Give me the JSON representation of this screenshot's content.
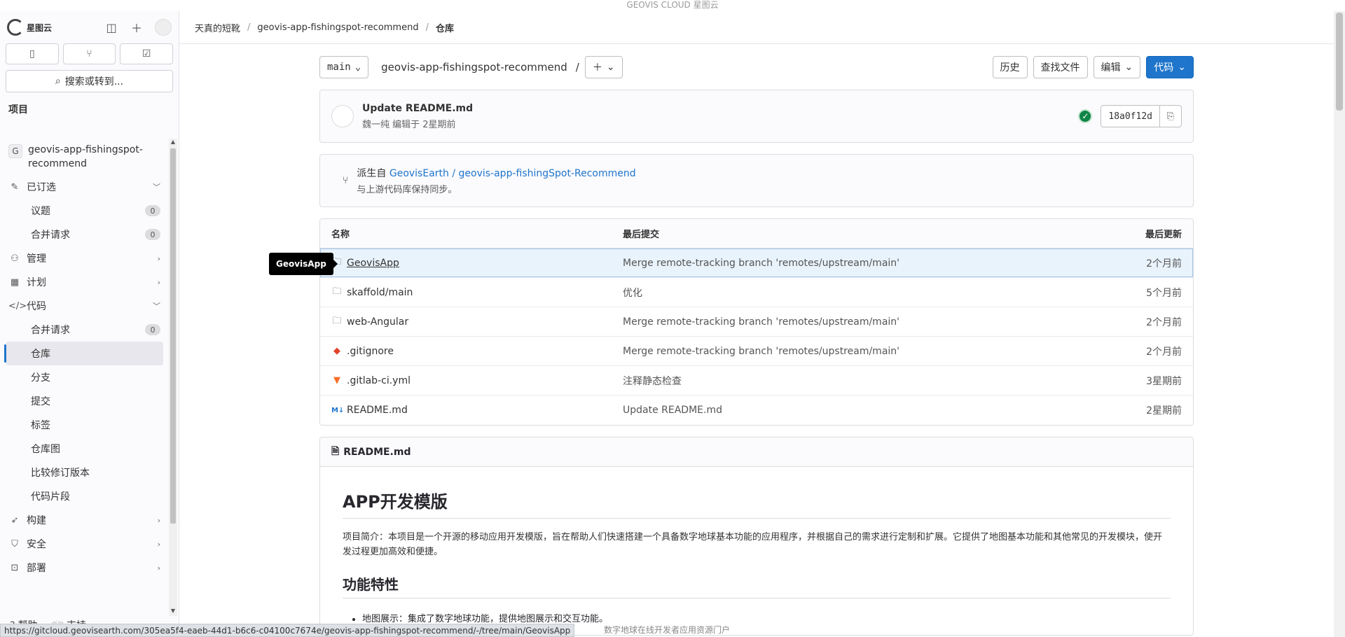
{
  "banner": "GEOVIS CLOUD 星图云",
  "sidebar": {
    "logo_text": "星图云",
    "search_label": "搜索或转到...",
    "section_title": "项目",
    "project_name": "geovis-app-fishingspot-recommend",
    "project_initial": "G",
    "pinned": {
      "label": "已订选",
      "items": [
        {
          "label": "议题",
          "count": "0"
        },
        {
          "label": "合并请求",
          "count": "0"
        }
      ]
    },
    "manage": "管理",
    "plan": "计划",
    "code": {
      "label": "代码",
      "items": [
        {
          "label": "合并请求",
          "count": "0"
        },
        {
          "label": "仓库"
        },
        {
          "label": "分支"
        },
        {
          "label": "提交"
        },
        {
          "label": "标签"
        },
        {
          "label": "仓库图"
        },
        {
          "label": "比较修订版本"
        },
        {
          "label": "代码片段"
        }
      ]
    },
    "build": "构建",
    "secure": "安全",
    "deploy": "部署",
    "help": "帮助",
    "support": "支持"
  },
  "breadcrumb": {
    "a": "天真的短靴",
    "b": "geovis-app-fishingspot-recommend",
    "c": "仓库"
  },
  "toolbar": {
    "branch": "main",
    "path": "geovis-app-fishingspot-recommend",
    "path_sep": "/",
    "history": "历史",
    "find_file": "查找文件",
    "edit": "编辑",
    "code": "代码"
  },
  "commit": {
    "title": "Update README.md",
    "meta": "魏一纯 编辑于 2星期前",
    "sha": "18a0f12d"
  },
  "fork": {
    "prefix": "派生自",
    "link": "GeovisEarth / geovis-app-fishingSpot-Recommend",
    "sub": "与上游代码库保持同步。"
  },
  "files": {
    "headers": {
      "name": "名称",
      "commit": "最后提交",
      "date": "最后更新"
    },
    "rows": [
      {
        "name": "GeovisApp",
        "commit": "Merge remote-tracking branch 'remotes/upstream/main'",
        "date": "2个月前"
      },
      {
        "name": "skaffold/main",
        "commit": "优化",
        "date": "5个月前"
      },
      {
        "name": "web-Angular",
        "commit": "Merge remote-tracking branch 'remotes/upstream/main'",
        "date": "2个月前"
      },
      {
        "name": ".gitignore",
        "commit": "Merge remote-tracking branch 'remotes/upstream/main'",
        "date": "2个月前"
      },
      {
        "name": ".gitlab-ci.yml",
        "commit": "注释静态检查",
        "date": "3星期前"
      },
      {
        "name": "README.md",
        "commit": "Update README.md",
        "date": "2星期前"
      }
    ]
  },
  "tooltip": "GeovisApp",
  "readme": {
    "file": "README.md",
    "h1": "APP开发模版",
    "intro": "项目简介：本项目是一个开源的移动应用开发模版，旨在帮助人们快速搭建一个具备数字地球基本功能的应用程序，并根据自己的需求进行定制和扩展。它提供了地图基本功能和其他常见的开发模块，使开发过程更加高效和便捷。",
    "h2": "功能特性",
    "li1": "地图展示：集成了数字地球功能，提供地图展示和交互功能。"
  },
  "status_url": "https://gitcloud.geovisearth.com/305ea5f4-eaeb-44d1-b6c6-c04100c7674e/geovis-app-fishingspot-recommend/-/tree/main/GeovisApp",
  "footer": "数字地球在线开发者应用资源门户"
}
